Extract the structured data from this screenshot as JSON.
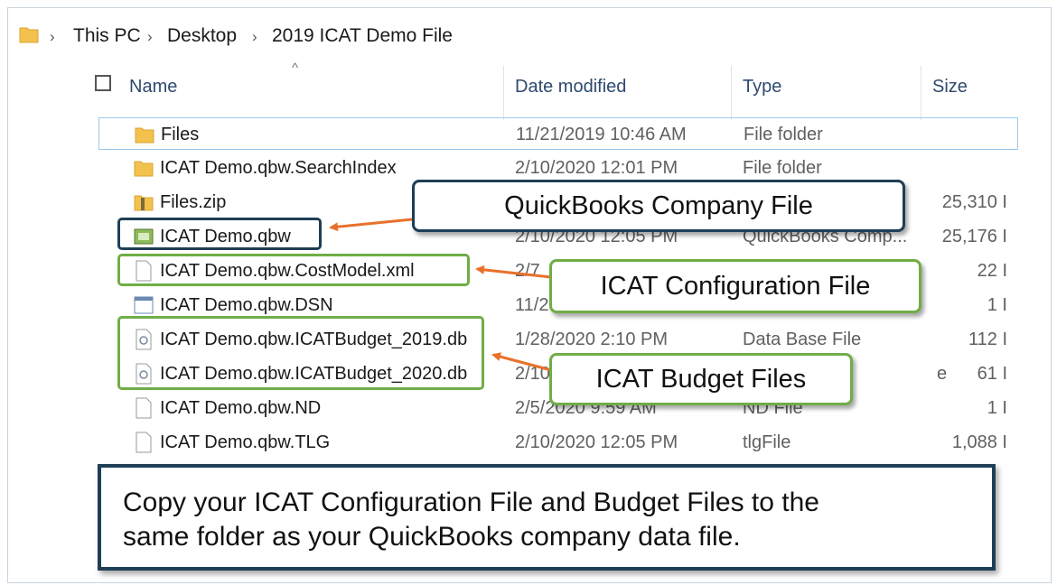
{
  "breadcrumb": [
    "This PC",
    "Desktop",
    "2019 ICAT Demo File"
  ],
  "columns": {
    "name": "Name",
    "date": "Date modified",
    "type": "Type",
    "size": "Size"
  },
  "rows": [
    {
      "name": "Files",
      "date": "11/21/2019 10:46 AM",
      "type": "File folder",
      "size": "",
      "icon": "folder-icon"
    },
    {
      "name": "ICAT Demo.qbw.SearchIndex",
      "date": "2/10/2020 12:01 PM",
      "type": "File folder",
      "size": "",
      "icon": "folder-icon"
    },
    {
      "name": "Files.zip",
      "date": "",
      "type": "",
      "size": "25,310 I",
      "icon": "zip-folder-icon"
    },
    {
      "name": "ICAT Demo.qbw",
      "date": "2/10/2020 12:05 PM",
      "type": "QuickBooks Comp...",
      "size": "25,176 I",
      "icon": "quickbooks-file-icon"
    },
    {
      "name": "ICAT Demo.qbw.CostModel.xml",
      "date": "2/7",
      "type": "",
      "size": "22 I",
      "icon": "document-icon"
    },
    {
      "name": "ICAT Demo.qbw.DSN",
      "date": "11/2",
      "type": "",
      "size": "1 I",
      "icon": "dsn-file-icon"
    },
    {
      "name": "ICAT Demo.qbw.ICATBudget_2019.db",
      "date": "1/28/2020 2:10 PM",
      "type": "Data Base File",
      "size": "112 I",
      "icon": "database-file-icon"
    },
    {
      "name": "ICAT Demo.qbw.ICATBudget_2020.db",
      "date": "2/10",
      "type": "e",
      "size": "61 I",
      "icon": "database-file-icon"
    },
    {
      "name": "ICAT Demo.qbw.ND",
      "date": "2/5/2020 9:59 AM",
      "type": "ND File",
      "size": "1 I",
      "icon": "document-icon"
    },
    {
      "name": "ICAT Demo.qbw.TLG",
      "date": "2/10/2020 12:05 PM",
      "type": "tlgFile",
      "size": "1,088 I",
      "icon": "document-icon"
    }
  ],
  "callouts": {
    "company_file": "QuickBooks Company File",
    "config_file": "ICAT Configuration File",
    "budget_files": "ICAT Budget Files"
  },
  "note": {
    "line1": "Copy your ICAT Configuration File and Budget Files to the",
    "line2": "same folder as your QuickBooks company data file."
  },
  "colors": {
    "navy": "#1e3e56",
    "green": "#70ad47",
    "arrow": "#e8712a",
    "folder": "#f2c14e"
  }
}
